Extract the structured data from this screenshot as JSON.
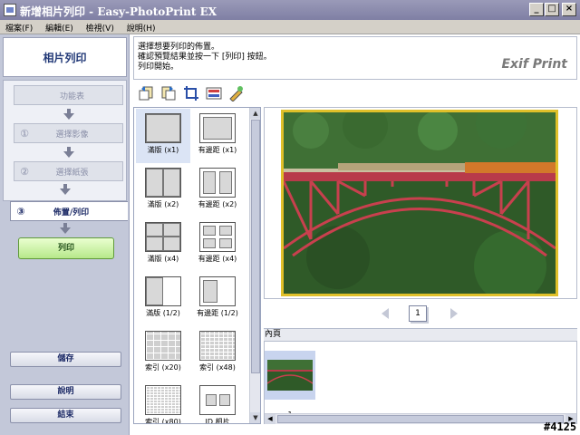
{
  "window": {
    "title": "新增相片列印 - Easy-PhotoPrint EX"
  },
  "menu": [
    "檔案(F)",
    "編輯(E)",
    "檢視(V)",
    "說明(H)"
  ],
  "sidebar": {
    "header": "相片列印",
    "steps": [
      {
        "num": "",
        "label": "功能表"
      },
      {
        "num": "①",
        "label": "選擇影像"
      },
      {
        "num": "②",
        "label": "選擇紙張"
      }
    ],
    "active_step": {
      "num": "③",
      "label": "佈置/列印"
    },
    "print_button": "列印",
    "save_button": "儲存",
    "help_button": "說明",
    "exit_button": "結束"
  },
  "instruction": {
    "lines": [
      "選擇想要列印的佈置。",
      "確認預覽結果並按一下 [列印] 按鈕。",
      "列印開始。"
    ],
    "logo": "Exif Print"
  },
  "layouts": [
    {
      "label": "滿版 (x1)",
      "selected": true
    },
    {
      "label": "有邊距 (x1)"
    },
    {
      "label": "滿版 (x2)"
    },
    {
      "label": "有邊距 (x2)"
    },
    {
      "label": "滿版 (x4)"
    },
    {
      "label": "有邊距 (x4)"
    },
    {
      "label": "滿版 (1/2)"
    },
    {
      "label": "有邊距 (1/2)"
    },
    {
      "label": "索引 (x20)"
    },
    {
      "label": "索引 (x48)"
    },
    {
      "label": "索引 (x80)"
    },
    {
      "label": "ID 相片"
    }
  ],
  "preview": {
    "page_number": "1"
  },
  "contents": {
    "header": "內頁",
    "pages": [
      {
        "label": "1"
      }
    ]
  },
  "watermark": "#4125",
  "colors": {
    "sidebar_bg": "#c3c8d9",
    "accent": "#233a78",
    "frame": "#e0c02a"
  }
}
